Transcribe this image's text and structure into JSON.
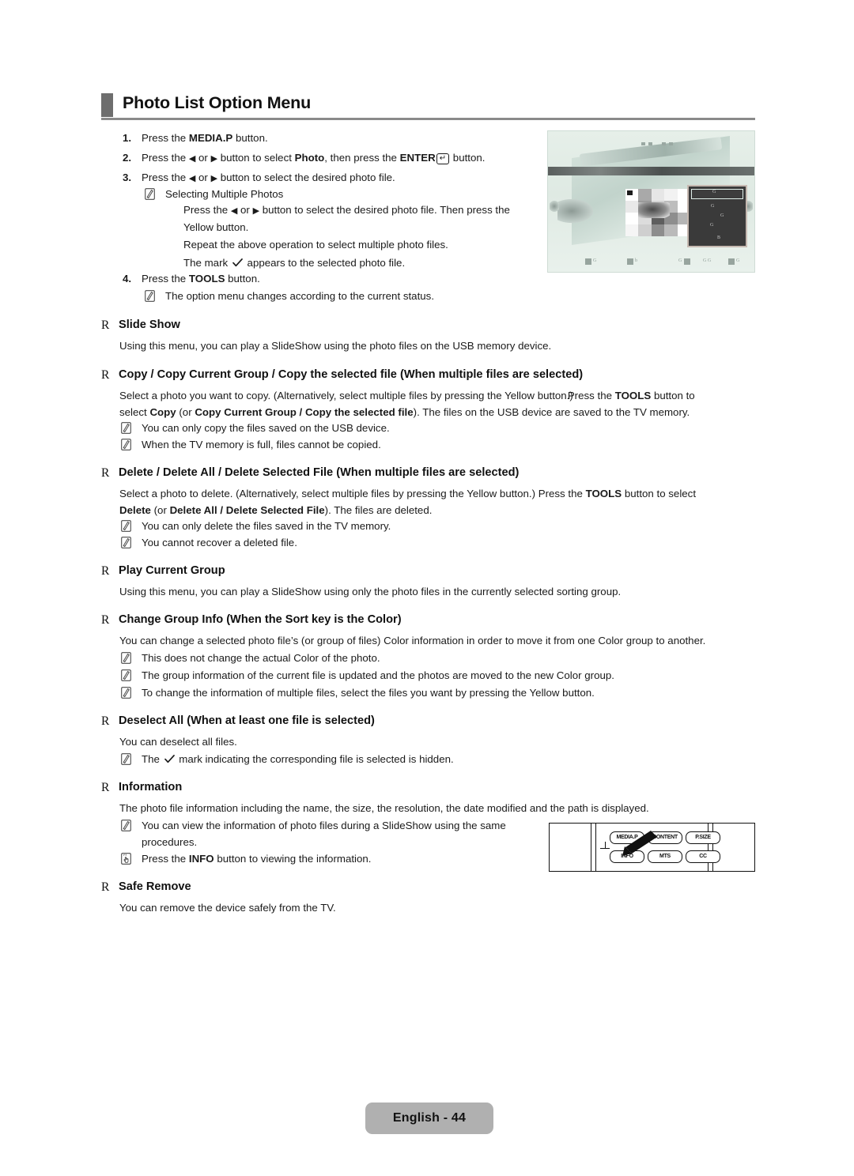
{
  "header": {
    "title": "Photo List Option Menu"
  },
  "steps": [
    {
      "num": "1.",
      "pre": "Press the ",
      "bold": "MEDIA.P",
      "post": " button.",
      "type": "simple"
    },
    {
      "num": "2.",
      "a": "Press the ",
      "t1": "◀",
      "b1": " or ",
      "t2": "▶",
      "b2": " button to select ",
      "bold": "Photo",
      "c": ", then press the ",
      "bold2": "ENTER",
      "key": "↵",
      "d": " button.",
      "type": "enter"
    },
    {
      "num": "3.",
      "a": "Press the ",
      "t1": "◀",
      "b1": " or ",
      "t2": "▶",
      "b2": " button to select the desired photo file.",
      "type": "arrows"
    },
    {
      "num": "4.",
      "pre": "Press the ",
      "bold": "TOOLS",
      "post": " button.",
      "type": "simple"
    }
  ],
  "sub_selecting": {
    "title": "Selecting Multiple Photos",
    "line1_a": "Press the ",
    "line1_t1": "◀",
    "line1_b": " or ",
    "line1_t2": "▶",
    "line1_c": " button to select the desired photo file. Then press the",
    "line2": "Yellow button.",
    "line3": "Repeat the above operation to select multiple photo files.",
    "line4_a": "The mark ",
    "line4_b": " appears to the selected photo file."
  },
  "note_tools": "The option menu changes according to the current status.",
  "sections": [
    {
      "marker": "R",
      "title": "Slide Show",
      "body": "Using this menu, you can play a SlideShow using the photo files on the USB memory device.",
      "notes": []
    },
    {
      "marker": "R",
      "title": "Copy / Copy Current Group / Copy the selected file (When multiple files are selected)",
      "body_l1_a": "Select a photo you want to copy. (Alternatively, select multiple files by pressing the Yellow button.)",
      "body_l1_b": "Press the ",
      "body_l1_bold": "TOOLS",
      "body_l1_c": " button to",
      "body_l2_a": "select ",
      "body_l2_bold1": "Copy",
      "body_l2_b": " (or ",
      "body_l2_bold2": "Copy Current Group / Copy the selected file",
      "body_l2_c": "). The files on the USB device are saved to the TV memory.",
      "notes": [
        "You can only copy the files saved on the USB device.",
        "When the TV memory is full, files cannot be copied."
      ]
    },
    {
      "marker": "R",
      "title": "Delete / Delete All / Delete Selected File (When multiple files are selected)",
      "body_l1_a": "Select a photo to delete. (Alternatively, select multiple files by pressing the Yellow button.) Press the ",
      "body_l1_bold": "TOOLS",
      "body_l1_c": " button to select",
      "body_l2_bold1": "Delete",
      "body_l2_b": " (or ",
      "body_l2_bold2": "Delete All / Delete Selected File",
      "body_l2_c": "). The files are deleted.",
      "notes": [
        "You can only delete the files saved in the TV memory.",
        "You cannot recover a deleted file."
      ]
    },
    {
      "marker": "R",
      "title": "Play Current Group",
      "body": "Using this menu, you can play a SlideShow using only the photo files in the currently selected sorting group.",
      "notes": []
    },
    {
      "marker": "R",
      "title": "Change Group Info (When the Sort key is the Color)",
      "body": "You can change a selected photo file’s (or group of files) Color information in order to move it from one Color group to another.",
      "notes": [
        "This does not change the actual Color of the photo.",
        "The group information of the current file is updated and the photos are moved to the new Color group.",
        "To change the information of multiple files, select the files you want by pressing the Yellow button."
      ]
    },
    {
      "marker": "R",
      "title": "Deselect All (When at least one file is selected)",
      "body": "You can deselect all files.",
      "note_check_a": "The ",
      "note_check_b": " mark indicating the corresponding file is selected is hidden."
    },
    {
      "marker": "R",
      "title": "Information",
      "body": "The photo file information including the name, the size, the resolution, the date modified and the path is displayed.",
      "note1_l1": "You can view the information of photo files during a SlideShow using the same",
      "note1_l2": "procedures.",
      "note2_a": "Press the ",
      "note2_bold": "INFO",
      "note2_b": " button to viewing the information."
    },
    {
      "marker": "R",
      "title": "Safe Remove",
      "body": "You can remove the device safely from the TV.",
      "notes": []
    }
  ],
  "remote": {
    "buttons_top": [
      "MEDIA.P",
      "CONTENT",
      "P.SIZE"
    ],
    "buttons_bottom": [
      "INFO",
      "MTS",
      "CC"
    ],
    "highlighted": "INFO"
  },
  "tv_screenshot": {
    "menu_items": [
      "G",
      "G",
      "G",
      "G",
      "B"
    ],
    "footer_labels": [
      "G",
      "b",
      "G",
      "G  G",
      "G"
    ]
  },
  "footer": {
    "page_label": "English - 44"
  },
  "colors": {
    "header_bar": "#6e6e6e",
    "header_rule": "#8a8a8a",
    "footer_pill": "#b0b0b0",
    "text": "#1a1a1a",
    "tv_bg": "#dfeae3"
  }
}
